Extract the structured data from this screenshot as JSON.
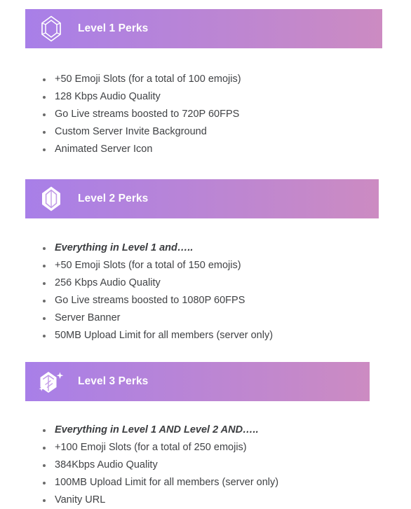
{
  "document": {
    "title": "Server Boost Level Perks"
  },
  "theme": {
    "gradient_start": "#a87fe8",
    "gradient_end": "#cc8bc2",
    "header_text_color": "#ffffff",
    "body_text_color": "#404245",
    "bullet_color": "#6b6b6b",
    "page_background": "#ffffff"
  },
  "sections": [
    {
      "id": "level-1",
      "title": "Level 1 Perks",
      "icon": "gem-outline-icon",
      "items": [
        {
          "text": "+50 Emoji Slots (for a total of 100 emojis)",
          "emphasis": false
        },
        {
          "text": "128 Kbps Audio Quality",
          "emphasis": false
        },
        {
          "text": "Go Live streams boosted to 720P 60FPS",
          "emphasis": false
        },
        {
          "text": "Custom Server Invite Background",
          "emphasis": false
        },
        {
          "text": "Animated Server Icon",
          "emphasis": false
        }
      ]
    },
    {
      "id": "level-2",
      "title": "Level 2 Perks",
      "icon": "gem-filled-icon",
      "items": [
        {
          "text": "Everything in Level 1 and…..",
          "emphasis": true
        },
        {
          "text": "+50 Emoji Slots (for a total of 150 emojis)",
          "emphasis": false
        },
        {
          "text": "256 Kbps Audio Quality",
          "emphasis": false
        },
        {
          "text": "Go Live streams boosted to 1080P 60FPS",
          "emphasis": false
        },
        {
          "text": "Server Banner",
          "emphasis": false
        },
        {
          "text": "50MB Upload Limit for all members (server only)",
          "emphasis": false
        }
      ]
    },
    {
      "id": "level-3",
      "title": "Level 3 Perks",
      "icon": "gem-sparkle-icon",
      "items": [
        {
          "text": "Everything in Level 1 AND Level 2 AND…..",
          "emphasis": true
        },
        {
          "text": "+100 Emoji Slots (for a total of 250 emojis)",
          "emphasis": false
        },
        {
          "text": "384Kbps Audio Quality",
          "emphasis": false
        },
        {
          "text": "100MB Upload Limit for all members (server only)",
          "emphasis": false
        },
        {
          "text": "Vanity URL",
          "emphasis": false
        }
      ]
    }
  ]
}
